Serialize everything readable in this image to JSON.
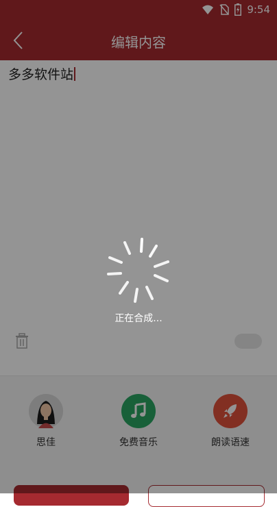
{
  "status_bar": {
    "time": "9:54",
    "icons": [
      "wifi-icon",
      "no-sim-icon",
      "battery-charging-icon"
    ]
  },
  "header": {
    "title": "编辑内容",
    "back_icon": "chevron-left-icon",
    "bg_color": "#a52a30"
  },
  "editor": {
    "text": "多多软件站"
  },
  "bottom": {
    "options": [
      {
        "label": "思佳",
        "icon": "avatar-female-icon"
      },
      {
        "label": "免费音乐",
        "icon": "music-note-icon",
        "color": "#2aa663"
      },
      {
        "label": "朗读语速",
        "icon": "rocket-icon",
        "color": "#e0523b"
      }
    ]
  },
  "loading": {
    "text": "正在合成..."
  }
}
